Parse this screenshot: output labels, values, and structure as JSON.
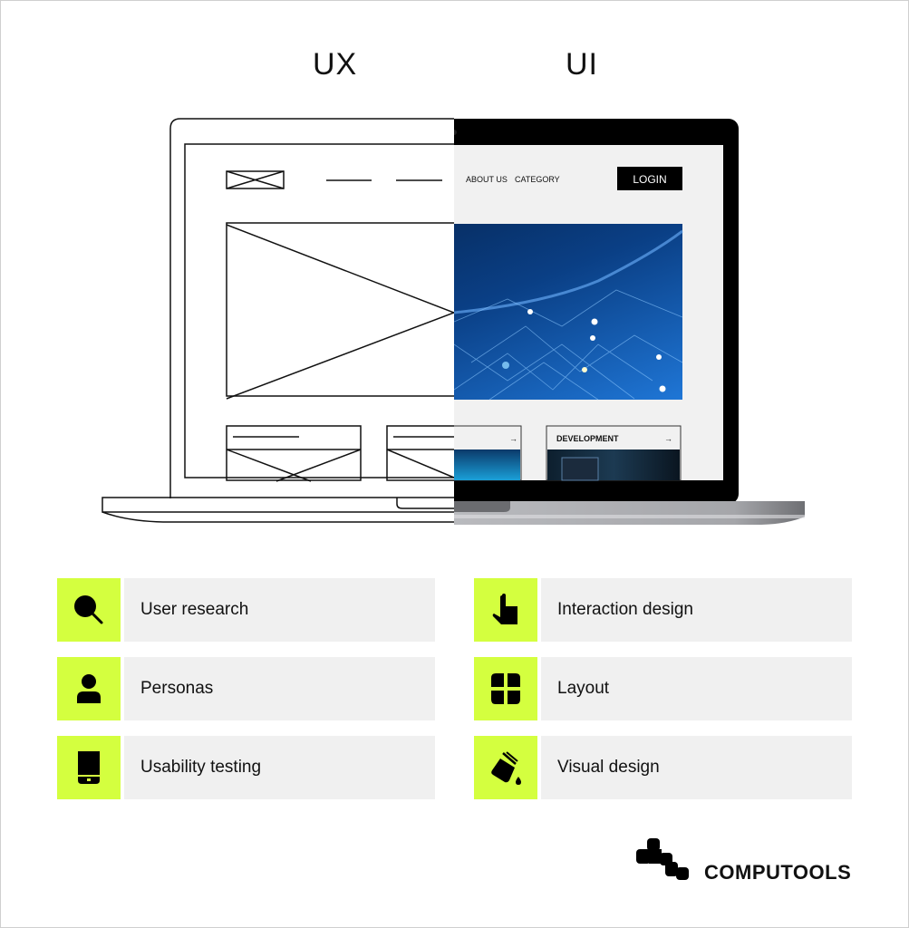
{
  "headings": {
    "ux": "UX",
    "ui": "UI"
  },
  "mockup": {
    "nav_links": [
      "ABOUT US",
      "CATEGORY"
    ],
    "login_button": "LOGIN",
    "cards": [
      {
        "label": "",
        "arrow": "→"
      },
      {
        "label": "DEVELOPMENT",
        "arrow": "→"
      }
    ]
  },
  "features": {
    "ux": [
      {
        "icon": "search-icon",
        "label": "User research"
      },
      {
        "icon": "person-icon",
        "label": "Personas"
      },
      {
        "icon": "mobile-device-icon",
        "label": "Usability testing"
      }
    ],
    "ui": [
      {
        "icon": "pointer-hand-icon",
        "label": "Interaction design"
      },
      {
        "icon": "grid-layout-icon",
        "label": "Layout"
      },
      {
        "icon": "paint-bucket-icon",
        "label": "Visual design"
      }
    ]
  },
  "brand": {
    "name": "COMPUTOOLS"
  },
  "colors": {
    "accent": "#d4ff3f",
    "label_bg": "#f0f0f0",
    "text": "#111111"
  }
}
